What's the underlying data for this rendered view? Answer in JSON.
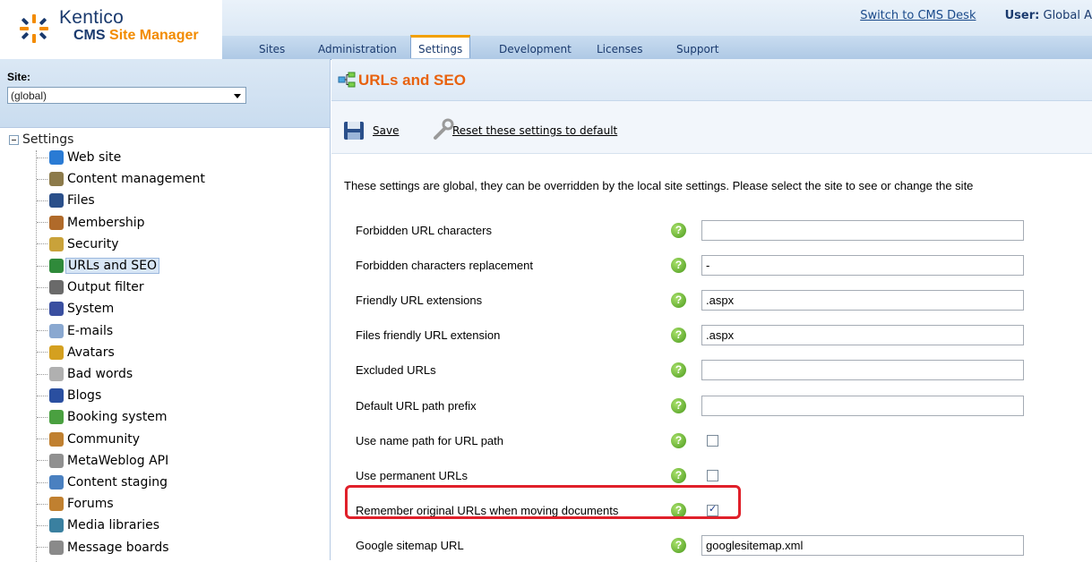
{
  "brand": {
    "name": "Kentico",
    "product_prefix": "CMS",
    "product_suffix": "Site Manager"
  },
  "top_links": {
    "switch": "Switch to CMS Desk",
    "user_label": "User:",
    "user_value": "Global A"
  },
  "tabs": [
    {
      "label": "Sites"
    },
    {
      "label": "Administration"
    },
    {
      "label": "Settings"
    },
    {
      "label": "Development"
    },
    {
      "label": "Licenses"
    },
    {
      "label": "Support"
    }
  ],
  "active_tab": "Settings",
  "site": {
    "label": "Site:",
    "selected": "(global)"
  },
  "tree": {
    "root": "Settings",
    "items": [
      {
        "label": "Web site",
        "icon": "globe-icon",
        "color": "#2a7bd4"
      },
      {
        "label": "Content management",
        "icon": "document-pen-icon",
        "color": "#8c7a4a"
      },
      {
        "label": "Files",
        "icon": "floppy-icon",
        "color": "#2a4f8a"
      },
      {
        "label": "Membership",
        "icon": "user-icon",
        "color": "#b06a2a"
      },
      {
        "label": "Security",
        "icon": "keys-icon",
        "color": "#c9a23a"
      },
      {
        "label": "URLs and SEO",
        "icon": "sitemap-icon",
        "color": "#2f8a3a"
      },
      {
        "label": "Output filter",
        "icon": "filter-icon",
        "color": "#6a6a6a"
      },
      {
        "label": "System",
        "icon": "computer-icon",
        "color": "#3a4fa0"
      },
      {
        "label": "E-mails",
        "icon": "envelope-icon",
        "color": "#8aa8d0"
      },
      {
        "label": "Avatars",
        "icon": "avatar-icon",
        "color": "#d4a020"
      },
      {
        "label": "Bad words",
        "icon": "bad-words-icon",
        "color": "#b0b0b0"
      },
      {
        "label": "Blogs",
        "icon": "book-icon",
        "color": "#2a4fa0"
      },
      {
        "label": "Booking system",
        "icon": "calendar-icon",
        "color": "#4aa040"
      },
      {
        "label": "Community",
        "icon": "group-icon",
        "color": "#c08030"
      },
      {
        "label": "MetaWeblog API",
        "icon": "link-icon",
        "color": "#909090"
      },
      {
        "label": "Content staging",
        "icon": "staging-icon",
        "color": "#4a80c0"
      },
      {
        "label": "Forums",
        "icon": "forums-icon",
        "color": "#c08030"
      },
      {
        "label": "Media libraries",
        "icon": "media-icon",
        "color": "#3a80a0"
      },
      {
        "label": "Message boards",
        "icon": "board-icon",
        "color": "#8a8a8a"
      }
    ],
    "selected": "URLs and SEO"
  },
  "page": {
    "title": "URLs and SEO",
    "save_label": "Save",
    "reset_label": "Reset these settings to default",
    "info": "These settings are global, they can be overridden by the local site settings. Please select the site to see or change the site"
  },
  "settings": [
    {
      "label": "Forbidden URL characters",
      "type": "text",
      "value": ""
    },
    {
      "label": "Forbidden characters replacement",
      "type": "text",
      "value": "-"
    },
    {
      "label": "Friendly URL extensions",
      "type": "text",
      "value": ".aspx"
    },
    {
      "label": "Files friendly URL extension",
      "type": "text",
      "value": ".aspx"
    },
    {
      "label": "Excluded URLs",
      "type": "text",
      "value": ""
    },
    {
      "label": "Default URL path prefix",
      "type": "text",
      "value": ""
    },
    {
      "label": "Use name path for URL path",
      "type": "checkbox",
      "checked": false
    },
    {
      "label": "Use permanent URLs",
      "type": "checkbox",
      "checked": false
    },
    {
      "label": "Remember original URLs when moving documents",
      "type": "checkbox",
      "checked": true
    },
    {
      "label": "Google sitemap URL",
      "type": "text",
      "value": "googlesitemap.xml"
    }
  ],
  "help_glyph": "?",
  "colors": {
    "title_orange": "#e8620f",
    "highlight_red": "#e0202a",
    "help_green": "#4a9a1c"
  }
}
